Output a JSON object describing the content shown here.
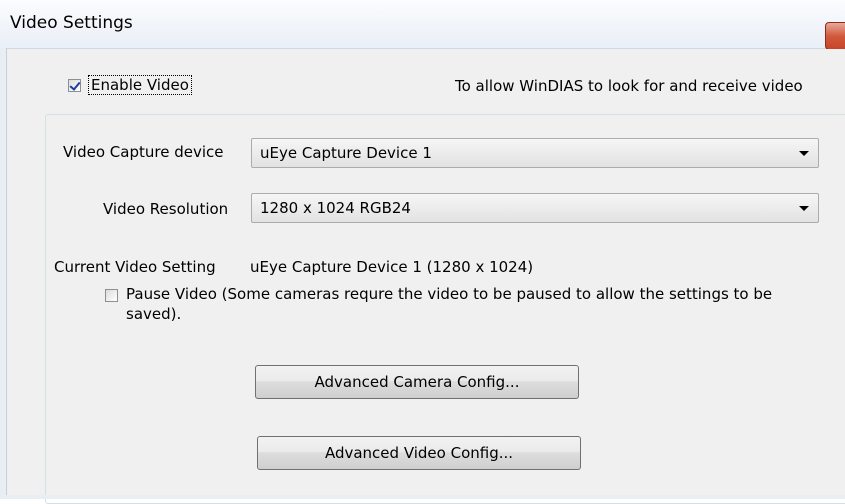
{
  "window": {
    "title": "Video Settings",
    "accent_close": "#c7432a"
  },
  "enable_video": {
    "label": "Enable Video",
    "checked": true,
    "description": "To allow WinDIAS to look for and receive video"
  },
  "capture_device": {
    "label": "Video Capture device",
    "value": "uEye Capture Device 1"
  },
  "resolution": {
    "label": "Video Resolution",
    "value": "1280 x 1024  RGB24"
  },
  "current_setting": {
    "label": "Current Video Setting",
    "value": "uEye Capture Device 1  (1280 x 1024)"
  },
  "pause_video": {
    "label": "Pause Video (Some cameras requre the video to be paused to allow the settings to be saved).",
    "checked": false
  },
  "buttons": {
    "advanced_camera": "Advanced Camera Config...",
    "advanced_video": "Advanced Video Config..."
  }
}
